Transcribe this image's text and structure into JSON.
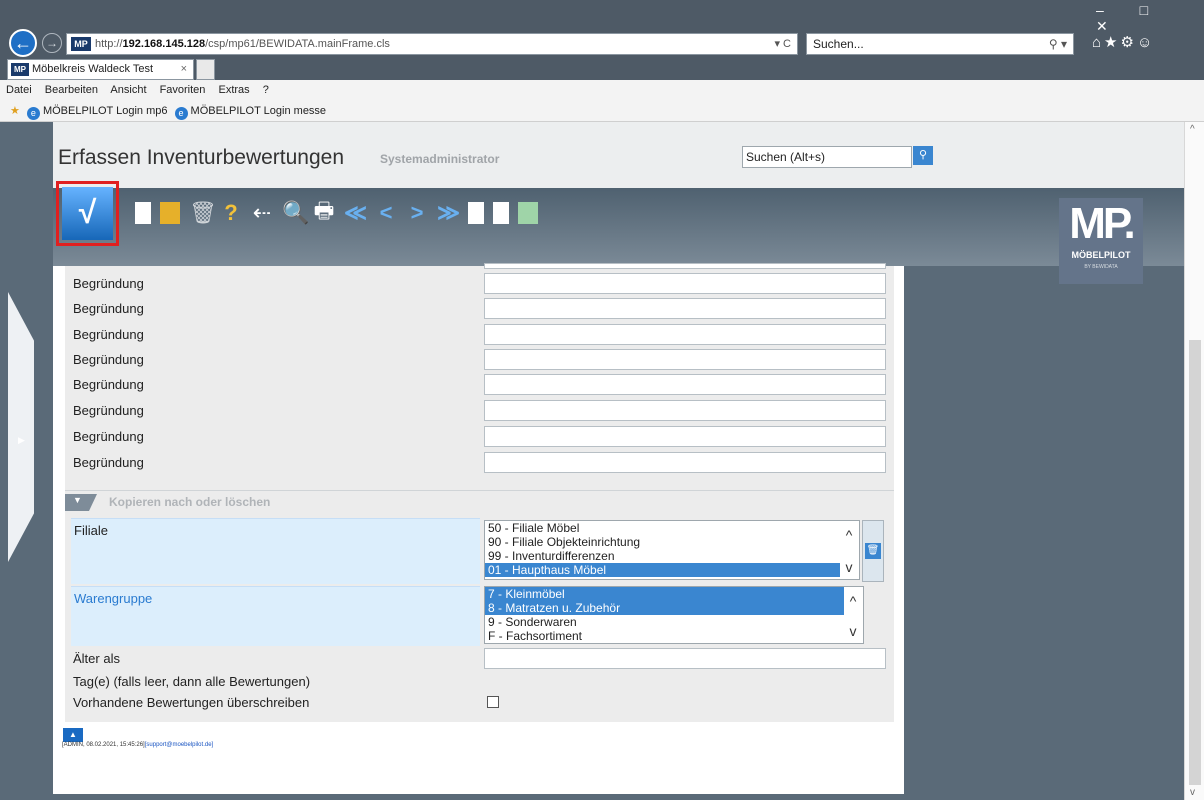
{
  "browser": {
    "window_controls": "–  □  ✕",
    "back_icon": "←",
    "forward_icon": "→",
    "mp_badge": "MP",
    "url_prefix": "http://",
    "url_host": "192.168.145.128",
    "url_path": "/csp/mp61/BEWIDATA.mainFrame.cls",
    "url_controls": "▾ C",
    "search_value": "Suchen...",
    "search_controls": "⚲ ▾",
    "toolbar_icons": "⌂★⚙☺",
    "tab_title": "Möbelkreis Waldeck Test",
    "tab_close": "×",
    "menu": [
      "Datei",
      "Bearbeiten",
      "Ansicht",
      "Favoriten",
      "Extras",
      "?"
    ],
    "favorites_star": "★",
    "favorites": [
      "MÖBELPILOT Login mp6",
      "MÖBELPILOT Login messe"
    ],
    "favorite_icon": "e"
  },
  "app": {
    "title": "Erfassen Inventurbewertungen",
    "subtitle": "Systemadministrator",
    "search_placeholder": "Suchen (Alt+s)",
    "search_btn": "⚲",
    "save_icon": "√",
    "toolbar_glyphs": {
      "trash": "🗑",
      "help": "?",
      "back": "⇠",
      "search": "🔍",
      "print": "🖶",
      "first": "≪",
      "prev": "<",
      "next": ">",
      "last": "≫"
    },
    "logo_big": "MP.",
    "logo_small": "MÖBELPILOT",
    "logo_tiny": "BY BEWIDATA",
    "side_arrow": "▶"
  },
  "form": {
    "begruendung_label": "Begründung",
    "section_arrow": "▼",
    "section_title": "Kopieren nach oder löschen",
    "filiale_label": "Filiale",
    "filiale_options": [
      "50 - Filiale Möbel",
      "90 - Filiale Objekteinrichtung",
      "99 - Inventurdifferenzen",
      "01 - Haupthaus Möbel"
    ],
    "filiale_selected": "01 - Haupthaus Möbel",
    "warengruppe_label": "Warengruppe",
    "warengruppe_options": [
      "7 - Kleinmöbel",
      "8 - Matratzen u. Zubehör",
      "9 - Sonderwaren",
      "F - Fachsortiment"
    ],
    "warengruppe_selected": [
      "7 - Kleinmöbel",
      "8 - Matratzen u. Zubehör"
    ],
    "aelter_label": "Älter als",
    "tage_label": "Tag(e) (falls leer, dann alle Bewertungen)",
    "overwrite_label": "Vorhandene Bewertungen überschreiben",
    "scroll_up": "^",
    "scroll_down": "v",
    "delete_icon": "🗑"
  },
  "footer": {
    "up_icon": "▲",
    "info": "[ADMIN, 08.02.2021, 15:45:26]",
    "link": "[support@moebelpilot.de]"
  },
  "scrollbar": {
    "up": "^",
    "down": "v"
  }
}
